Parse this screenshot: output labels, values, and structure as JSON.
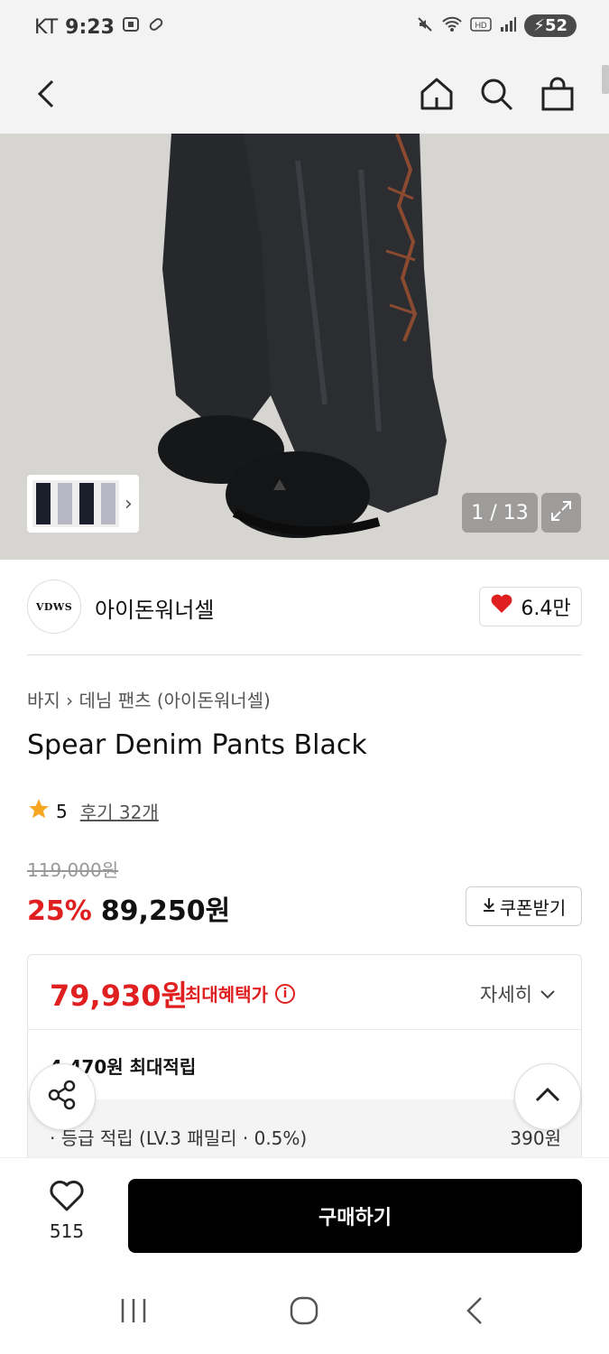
{
  "status_bar": {
    "carrier": "KT",
    "time": "9:23",
    "battery": "52"
  },
  "nav": {
    "back": "back-icon",
    "home": "home-icon",
    "search": "search-icon",
    "cart": "shopping-bag-icon"
  },
  "gallery": {
    "counter": "1 / 13"
  },
  "brand": {
    "logo_text": "VDWS",
    "name": "아이돈워너셀",
    "likes": "6.4만"
  },
  "product": {
    "breadcrumb_category": "바지",
    "breadcrumb_sub": "데님 팬츠 (아이돈워너셀)",
    "title": "Spear Denim Pants Black",
    "rating": "5",
    "reviews": "후기 32개",
    "original_price": "119,000원",
    "discount": "25%",
    "price": "89,250원",
    "coupon_label": "쿠폰받기"
  },
  "benefit": {
    "max_price": "79,930원",
    "max_label": "최대혜택가",
    "detail_label": "자세히",
    "points_total": "4,470원 최대적립",
    "points_label": "· 등급 적립 (LV.3 패밀리 · 0.5%)",
    "points_value": "390원"
  },
  "bottom": {
    "wish_count": "515",
    "buy_label": "구매하기"
  },
  "colors": {
    "accent_red": "#e02020",
    "buy_button": "#000000"
  }
}
